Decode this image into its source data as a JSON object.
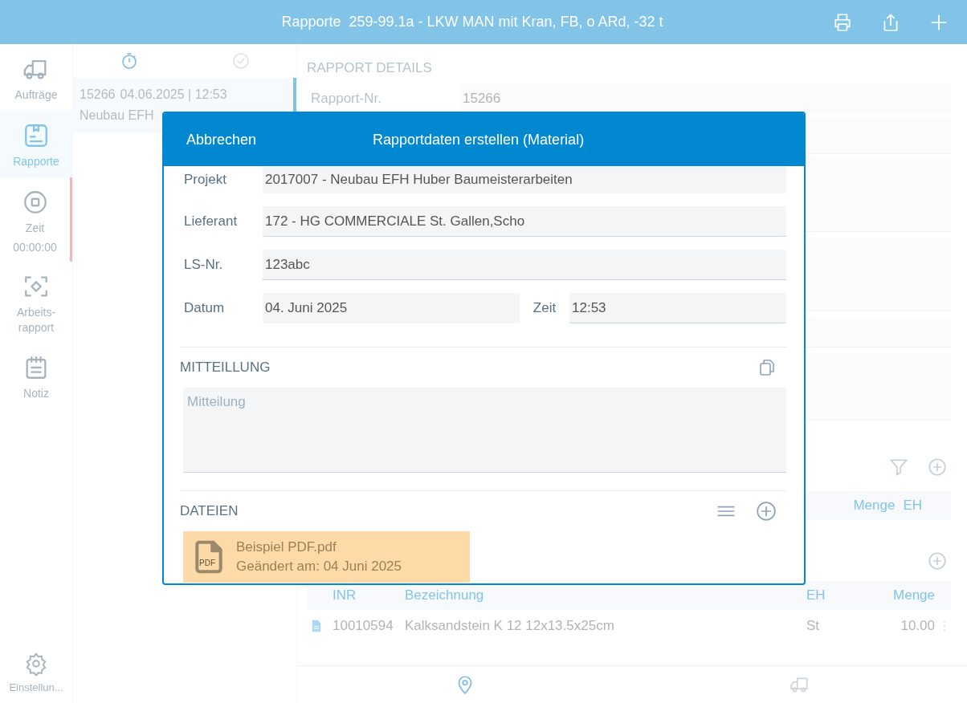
{
  "top_bar": {
    "title": "Rapporte",
    "vehicle": "259-99.1a - LKW MAN mit Kran, FB, o ARd, -32 t"
  },
  "sidebar": {
    "items": [
      {
        "kind": "truck",
        "label": "Aufträge",
        "selected": false,
        "alert": false
      },
      {
        "kind": "report",
        "label": "Rapporte",
        "selected": true,
        "alert": false
      },
      {
        "kind": "timer",
        "label": "Zeit",
        "time": "00:00:00",
        "selected": false,
        "alert": true
      },
      {
        "kind": "scan",
        "label": "Arbeits-\nrapport",
        "selected": false,
        "alert": false
      },
      {
        "kind": "note",
        "label": "Notiz",
        "selected": false,
        "alert": false
      }
    ],
    "settings": {
      "label": "Einstellun..."
    }
  },
  "list": {
    "tabs": [
      {
        "kind": "stopwatch",
        "selected": true
      },
      {
        "kind": "check",
        "selected": false
      }
    ],
    "items": [
      {
        "number": "15266",
        "datetime": "04.06.2025 | 12:53",
        "project": "Neubau EFH",
        "selected": true
      }
    ]
  },
  "details": {
    "heading": "RAPPORT DETAILS",
    "fields": [
      {
        "label": "Rapport-Nr.",
        "value": "15266"
      }
    ],
    "table_1": {
      "columns": [
        "Menge",
        "EH"
      ]
    },
    "table_2": {
      "columns": [
        "INR",
        "Bezeichnung",
        "EH",
        "Menge"
      ],
      "rows": [
        {
          "inr": "10010594",
          "bezeichnung": "Kalksandstein K 12 12x13.5x25cm",
          "eh": "St",
          "menge": "10.00"
        }
      ]
    }
  },
  "bottom_nav": [
    {
      "kind": "location",
      "selected": true
    },
    {
      "kind": "truck",
      "selected": false
    }
  ],
  "dialog": {
    "cancel": "Abbrechen",
    "title": "Rapportdaten erstellen (Material)",
    "fields": [
      {
        "label": "Projekt",
        "value": "2017007 - Neubau EFH Huber Baumeisterarbeiten",
        "kind": "picker"
      },
      {
        "label": "Lieferant",
        "value": "172 - HG COMMERCIALE St. Gallen,Scho",
        "kind": "input"
      },
      {
        "label": "LS-Nr.",
        "value": "123abc",
        "kind": "input"
      }
    ],
    "date": {
      "label": "Datum",
      "value": "04. Juni 2025",
      "kind": "picker"
    },
    "time": {
      "label": "Zeit",
      "value": "12:53",
      "kind": "input"
    },
    "message": {
      "heading": "MITTEILLUNG",
      "placeholder": "Mitteilung"
    },
    "files": {
      "heading": "DATEIEN",
      "items": [
        {
          "icon_text": "PDF",
          "name": "Beispiel PDF.pdf",
          "modified": "Geändert am: 04 Juni 2025"
        }
      ]
    }
  }
}
